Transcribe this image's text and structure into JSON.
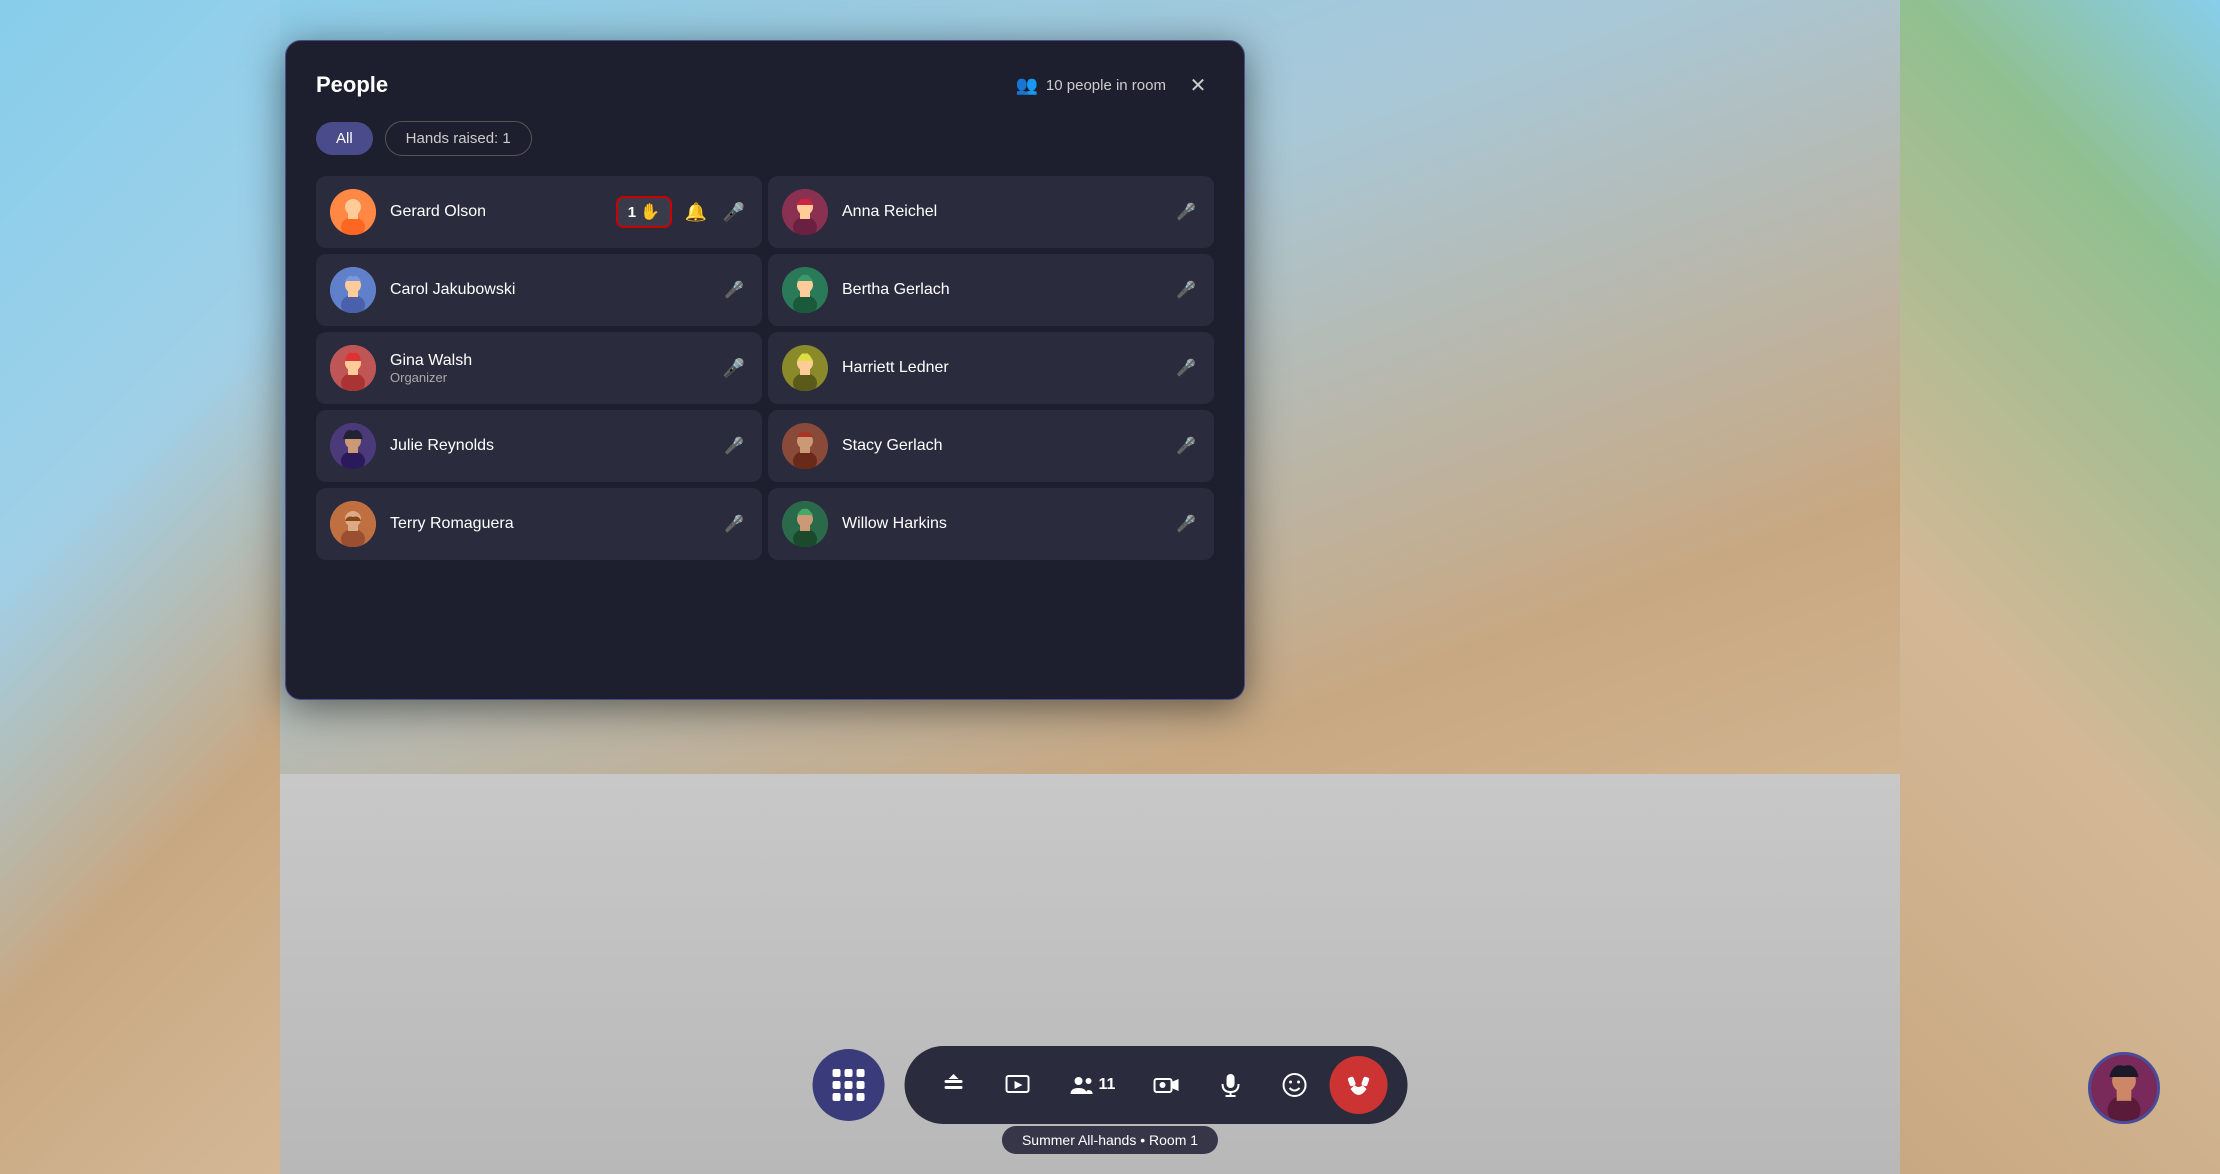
{
  "panel": {
    "title": "People",
    "people_count": "10 people in room",
    "close_label": "✕"
  },
  "tabs": {
    "all_label": "All",
    "hands_label": "Hands raised: 1"
  },
  "people": [
    {
      "id": "gerard",
      "name": "Gerard Olson",
      "role": "",
      "has_hand": true,
      "hand_count": "1",
      "mic": "active",
      "avatar_emoji": "🧑",
      "avatar_class": "avatar-gerard",
      "column": "left"
    },
    {
      "id": "anna",
      "name": "Anna Reichel",
      "role": "",
      "has_hand": false,
      "mic": "muted",
      "avatar_emoji": "👩",
      "avatar_class": "avatar-anna",
      "column": "right"
    },
    {
      "id": "carol",
      "name": "Carol Jakubowski",
      "role": "",
      "has_hand": false,
      "mic": "muted",
      "avatar_emoji": "👩",
      "avatar_class": "avatar-carol",
      "column": "left"
    },
    {
      "id": "bertha",
      "name": "Bertha Gerlach",
      "role": "",
      "has_hand": false,
      "mic": "muted",
      "avatar_emoji": "👩",
      "avatar_class": "avatar-bertha",
      "column": "right"
    },
    {
      "id": "gina",
      "name": "Gina Walsh",
      "role": "Organizer",
      "has_hand": false,
      "mic": "active",
      "avatar_emoji": "👩",
      "avatar_class": "avatar-gina",
      "column": "left"
    },
    {
      "id": "harriett",
      "name": "Harriett Ledner",
      "role": "",
      "has_hand": false,
      "mic": "muted",
      "avatar_emoji": "👩",
      "avatar_class": "avatar-harriett",
      "column": "right"
    },
    {
      "id": "julie",
      "name": "Julie Reynolds",
      "role": "",
      "has_hand": false,
      "mic": "muted",
      "avatar_emoji": "👩",
      "avatar_class": "avatar-julie",
      "column": "left"
    },
    {
      "id": "stacy",
      "name": "Stacy Gerlach",
      "role": "",
      "has_hand": false,
      "mic": "muted",
      "avatar_emoji": "👩",
      "avatar_class": "avatar-stacy",
      "column": "right"
    },
    {
      "id": "terry",
      "name": "Terry Romaguera",
      "role": "",
      "has_hand": false,
      "mic": "muted",
      "avatar_emoji": "🧔",
      "avatar_class": "avatar-terry",
      "column": "left"
    },
    {
      "id": "willow",
      "name": "Willow Harkins",
      "role": "",
      "has_hand": false,
      "mic": "muted",
      "avatar_emoji": "👩",
      "avatar_class": "avatar-willow",
      "column": "right"
    }
  ],
  "toolbar": {
    "apps_label": "⊞",
    "view_label": "⬆",
    "media_label": "🎬",
    "participants_count": "11",
    "camera_label": "📷",
    "mic_label": "🎤",
    "emoji_label": "😊",
    "end_label": "☎",
    "room_label": "Summer All-hands • Room 1"
  }
}
